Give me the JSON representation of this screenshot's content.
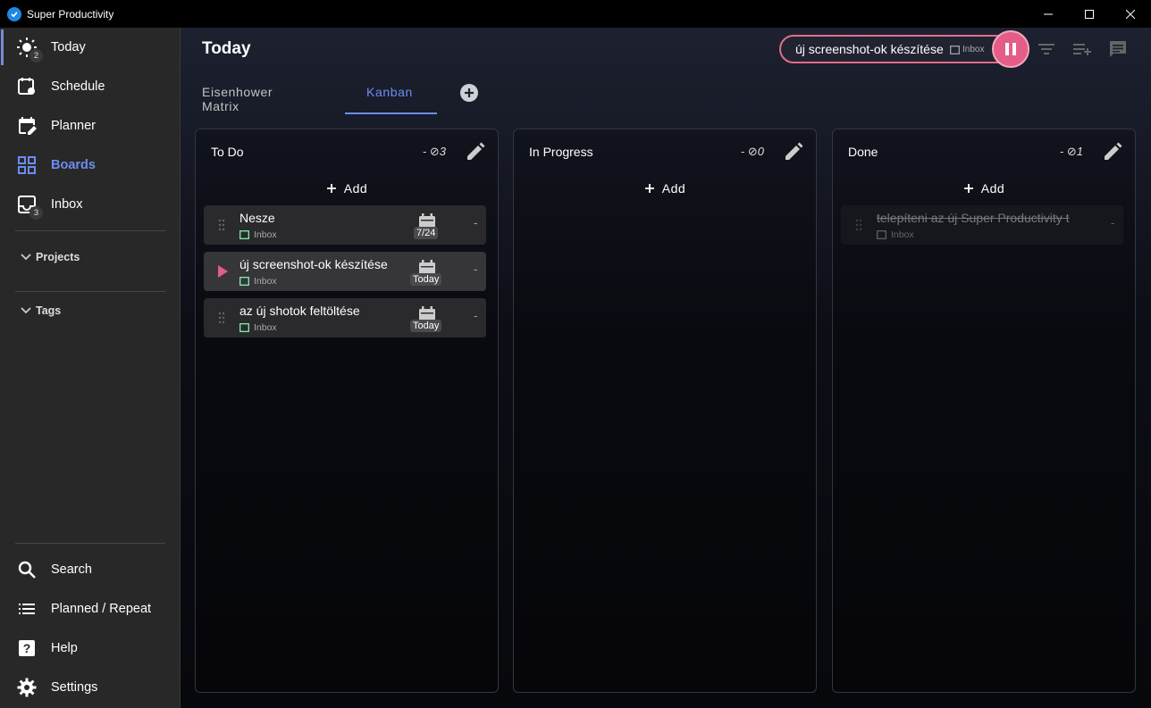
{
  "window": {
    "title": "Super Productivity"
  },
  "sidebar": {
    "items": [
      {
        "label": "Today",
        "badge": "2"
      },
      {
        "label": "Schedule"
      },
      {
        "label": "Planner"
      },
      {
        "label": "Boards"
      },
      {
        "label": "Inbox",
        "badge": "3"
      }
    ],
    "groups": [
      "Projects",
      "Tags"
    ],
    "bottom_items": [
      {
        "label": "Search"
      },
      {
        "label": "Planned / Repeat"
      },
      {
        "label": "Help"
      },
      {
        "label": "Settings"
      }
    ]
  },
  "header": {
    "title": "Today",
    "current_task": {
      "title": "új screenshot-ok készítése",
      "project": "Inbox"
    }
  },
  "tabs": [
    {
      "label": "Eisenhower Matrix"
    },
    {
      "label": "Kanban"
    }
  ],
  "columns": [
    {
      "title": "To Do",
      "count": "- ⊘3",
      "add_label": "Add",
      "tasks": [
        {
          "title": "Nesze",
          "project": "Inbox",
          "due": "7/24",
          "extra": "-"
        },
        {
          "title": "új screenshot-ok készítése",
          "project": "Inbox",
          "due": "Today",
          "extra": "-"
        },
        {
          "title": "az új shotok feltöltése",
          "project": "Inbox",
          "due": "Today",
          "extra": "-"
        }
      ]
    },
    {
      "title": "In Progress",
      "count": "- ⊘0",
      "add_label": "Add",
      "tasks": []
    },
    {
      "title": "Done",
      "count": "- ⊘1",
      "add_label": "Add",
      "tasks": [
        {
          "title": "telepíteni az új Super Productivity t",
          "project": "Inbox",
          "extra": "-"
        }
      ]
    }
  ],
  "colors": {
    "accent": "#6e8cf0",
    "timer": "#e35d86"
  }
}
